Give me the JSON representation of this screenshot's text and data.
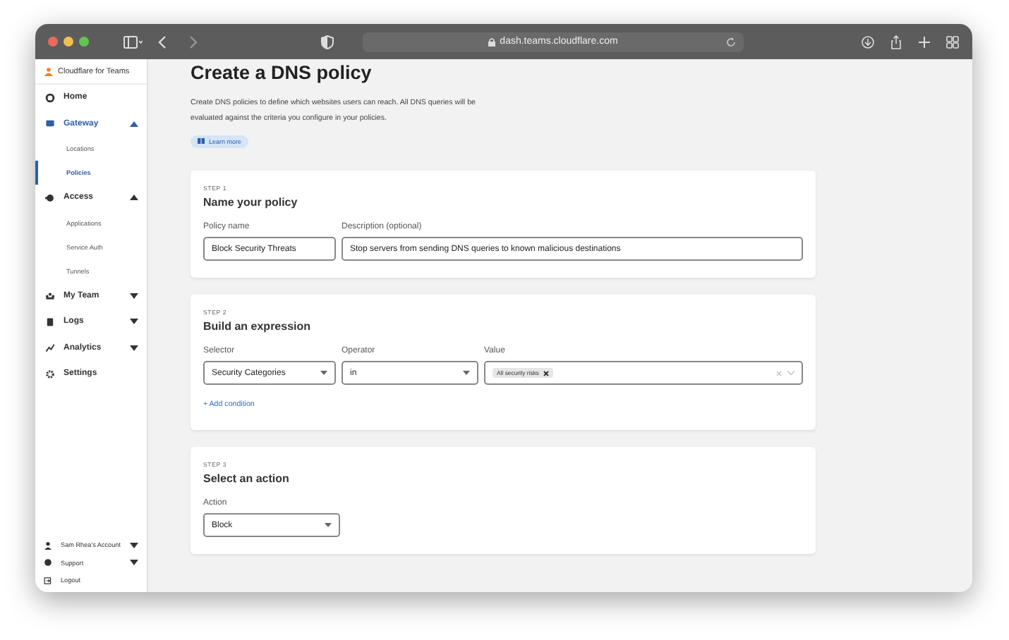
{
  "browser": {
    "url": "dash.teams.cloudflare.com"
  },
  "sidebar": {
    "brand": "Cloudflare for Teams",
    "items": [
      {
        "label": "Home",
        "kind": "link",
        "selected": false
      },
      {
        "label": "Gateway",
        "kind": "group",
        "selected": true,
        "expanded": true,
        "children": [
          {
            "label": "Locations",
            "selected": false
          },
          {
            "label": "Policies",
            "selected": true
          }
        ]
      },
      {
        "label": "Access",
        "kind": "group",
        "selected": false,
        "expanded": true,
        "children": [
          {
            "label": "Applications",
            "selected": false
          },
          {
            "label": "Service Auth",
            "selected": false
          },
          {
            "label": "Tunnels",
            "selected": false
          }
        ]
      },
      {
        "label": "My Team",
        "kind": "group",
        "selected": false,
        "expanded": false
      },
      {
        "label": "Logs",
        "kind": "group",
        "selected": false,
        "expanded": false
      },
      {
        "label": "Analytics",
        "kind": "group",
        "selected": false,
        "expanded": false
      },
      {
        "label": "Settings",
        "kind": "link",
        "selected": false
      }
    ],
    "footer": [
      {
        "label": "Sam Rhea's Account",
        "kind": "menu"
      },
      {
        "label": "Support",
        "kind": "menu"
      },
      {
        "label": "Logout",
        "kind": "link"
      }
    ]
  },
  "page": {
    "title": "Create a DNS policy",
    "description": "Create DNS policies to define which websites users can reach. All DNS queries will be evaluated against the criteria you configure in your policies.",
    "learn_more": "Learn more"
  },
  "steps": [
    {
      "step": "STEP 1",
      "title": "Name your policy",
      "fields": [
        {
          "kind": "input",
          "label": "Policy name",
          "value": "Block Security Threats"
        },
        {
          "kind": "input",
          "label": "Description (optional)",
          "value": "Stop servers from sending DNS queries to known malicious destinations"
        }
      ]
    },
    {
      "step": "STEP 2",
      "title": "Build an expression",
      "fields": [
        {
          "kind": "select",
          "label": "Selector",
          "value": "Security Categories"
        },
        {
          "kind": "select",
          "label": "Operator",
          "value": "in"
        },
        {
          "kind": "tags",
          "label": "Value",
          "tags": [
            "All security risks"
          ]
        }
      ],
      "add_condition": "+ Add condition"
    },
    {
      "step": "STEP 3",
      "title": "Select an action",
      "fields": [
        {
          "kind": "select",
          "label": "Action",
          "value": "Block"
        }
      ]
    }
  ]
}
